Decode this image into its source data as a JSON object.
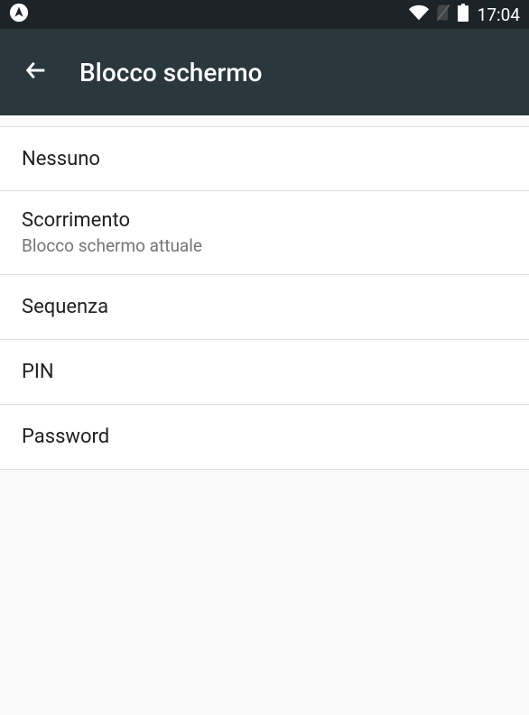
{
  "status": {
    "time": "17:04"
  },
  "header": {
    "title": "Blocco schermo"
  },
  "options": [
    {
      "title": "Nessuno",
      "subtitle": null
    },
    {
      "title": "Scorrimento",
      "subtitle": "Blocco schermo attuale"
    },
    {
      "title": "Sequenza",
      "subtitle": null
    },
    {
      "title": "PIN",
      "subtitle": null
    },
    {
      "title": "Password",
      "subtitle": null
    }
  ]
}
